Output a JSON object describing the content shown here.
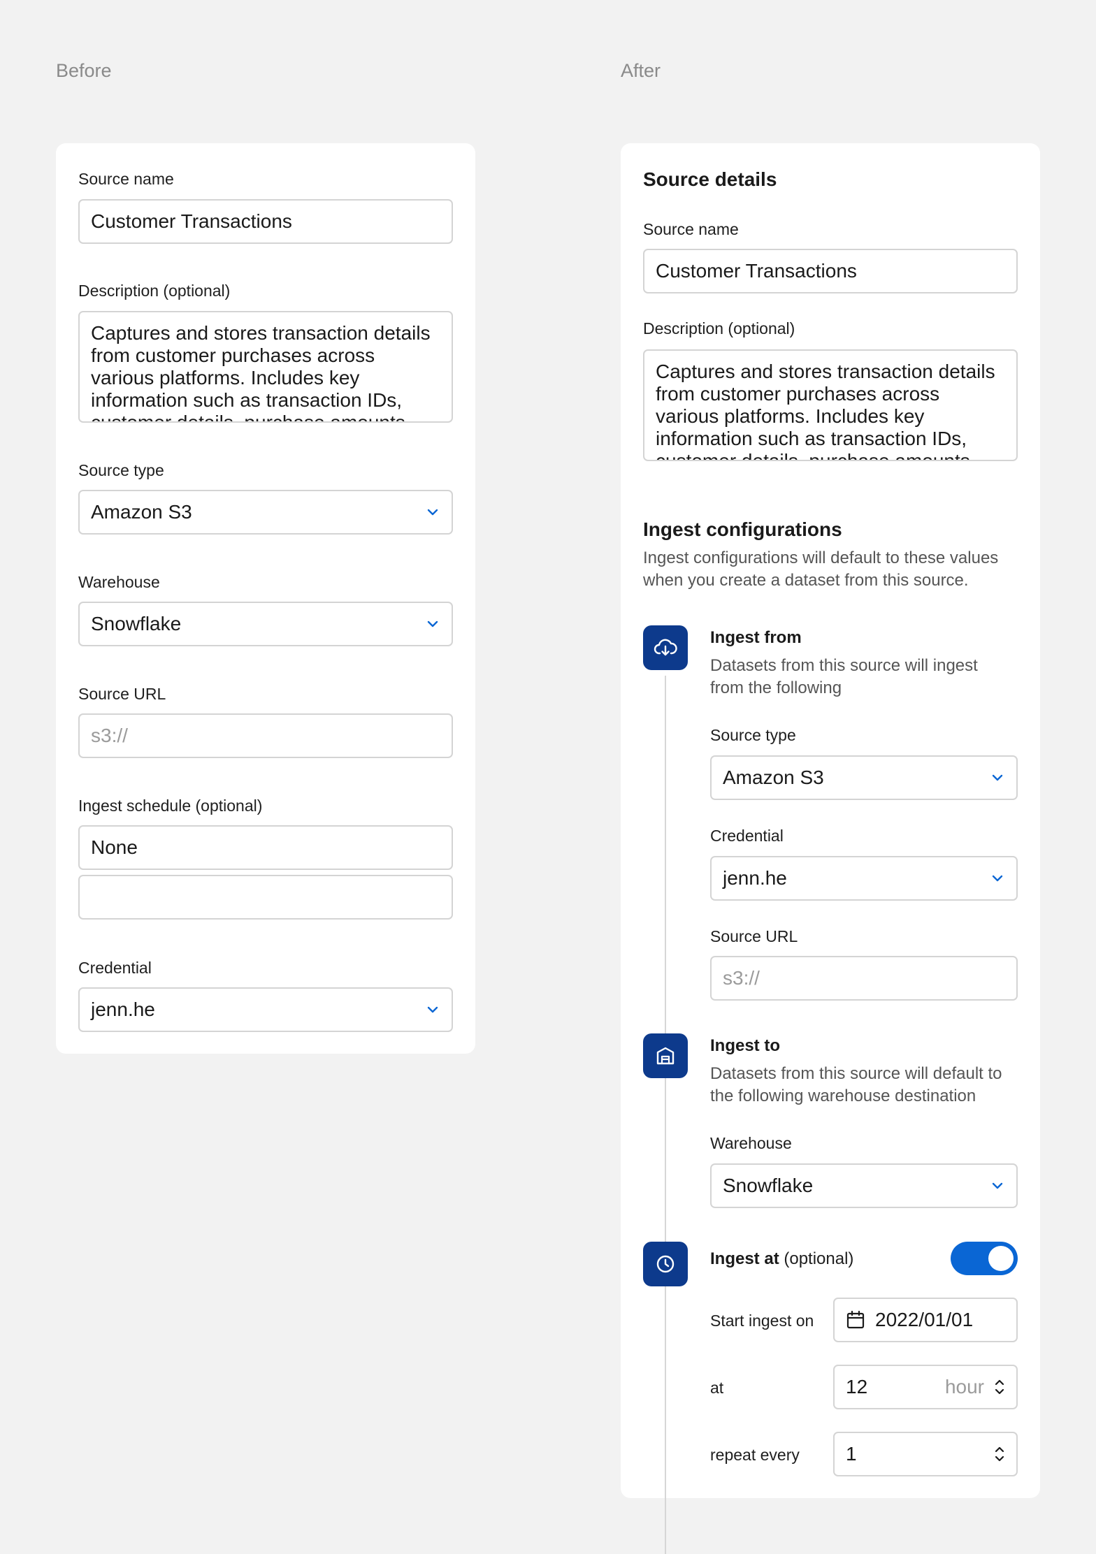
{
  "before": {
    "title": "Before",
    "source_name": {
      "label": "Source name",
      "value": "Customer Transactions"
    },
    "description": {
      "label": "Description (optional)",
      "value": "Captures and stores transaction details from customer purchases across various platforms. Includes key information such as transaction IDs, customer details, purchase amounts"
    },
    "source_type": {
      "label": "Source type",
      "value": "Amazon S3"
    },
    "warehouse": {
      "label": "Warehouse",
      "value": "Snowflake"
    },
    "source_url": {
      "label": "Source URL",
      "placeholder": "s3://"
    },
    "ingest_schedule": {
      "label": "Ingest schedule (optional)",
      "value": "None",
      "value2": ""
    },
    "credential": {
      "label": "Credential",
      "value": "jenn.he"
    }
  },
  "after": {
    "title": "After",
    "source_details": {
      "heading": "Source details",
      "source_name": {
        "label": "Source name",
        "value": "Customer Transactions"
      },
      "description": {
        "label": "Description (optional)",
        "value": "Captures and stores transaction details from customer purchases across various platforms. Includes key information such as transaction IDs, customer details, purchase amounts"
      }
    },
    "ingest": {
      "heading": "Ingest configurations",
      "subheading": "Ingest configurations will default to these values when you create a dataset from this source.",
      "from": {
        "icon": "cloud-download-icon",
        "title": "Ingest from",
        "desc": "Datasets from this source will ingest from the following",
        "source_type": {
          "label": "Source type",
          "value": "Amazon S3"
        },
        "credential": {
          "label": "Credential",
          "value": "jenn.he"
        },
        "source_url": {
          "label": "Source URL",
          "placeholder": "s3://"
        }
      },
      "to": {
        "icon": "warehouse-icon",
        "title": "Ingest to",
        "desc": "Datasets from this source will default to the following warehouse destination",
        "warehouse": {
          "label": "Warehouse",
          "value": "Snowflake"
        }
      },
      "at": {
        "icon": "clock-icon",
        "title": "Ingest at",
        "optional": "(optional)",
        "enabled": true,
        "start_label": "Start ingest on",
        "start_value": "2022/01/01",
        "at_label": "at",
        "at_value": "12",
        "at_unit": "hour",
        "repeat_label": "repeat every",
        "repeat_value": "1"
      }
    }
  },
  "colors": {
    "accent": "#0a66d4",
    "icon_bg": "#0d3a8c",
    "border": "#d4d4d4",
    "page_bg": "#f2f2f2"
  }
}
